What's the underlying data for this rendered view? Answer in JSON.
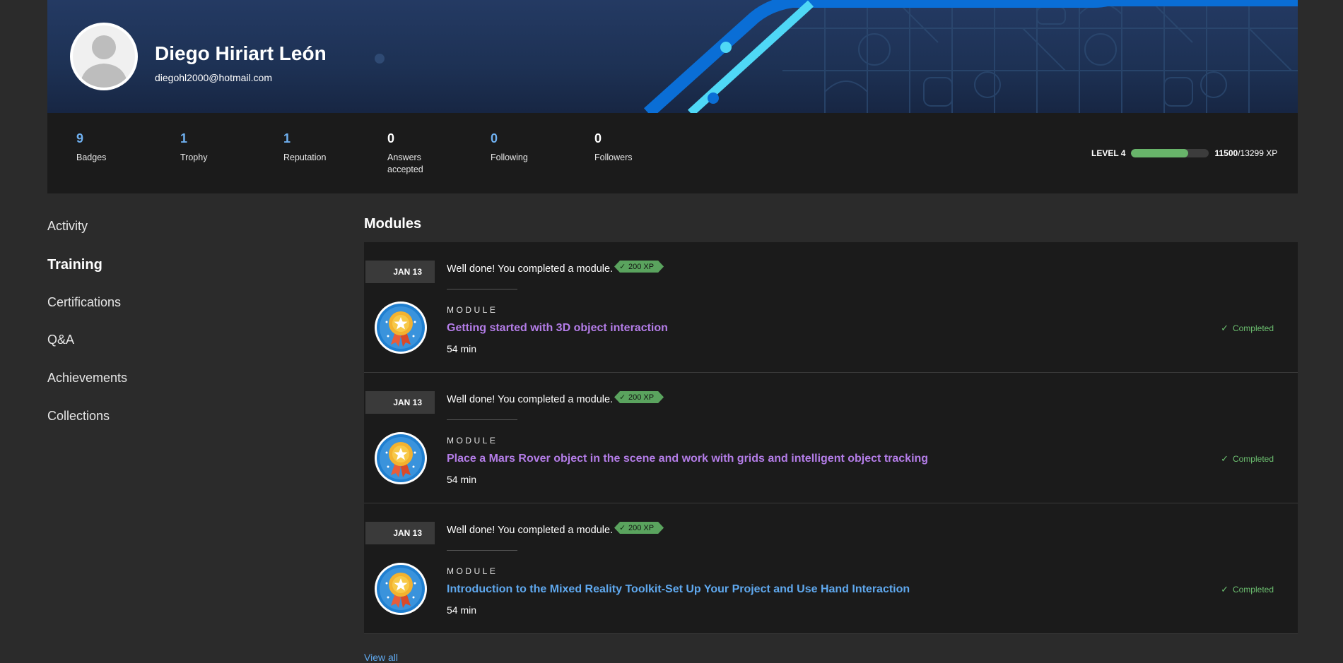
{
  "profile": {
    "name": "Diego Hiriart León",
    "email": "diegohl2000@hotmail.com"
  },
  "stats": [
    {
      "value": "9",
      "label": "Badges",
      "color": "blue"
    },
    {
      "value": "1",
      "label": "Trophy",
      "color": "blue"
    },
    {
      "value": "1",
      "label": "Reputation",
      "color": "blue"
    },
    {
      "value": "0",
      "label": "Answers accepted",
      "color": "white"
    },
    {
      "value": "0",
      "label": "Following",
      "color": "blue"
    },
    {
      "value": "0",
      "label": "Followers",
      "color": "white"
    }
  ],
  "level": {
    "label": "LEVEL 4",
    "xp_current": "11500",
    "xp_total": "/13299 XP",
    "progress_fraction": 0.73
  },
  "nav": {
    "items": [
      {
        "label": "Activity"
      },
      {
        "label": "Training"
      },
      {
        "label": "Certifications"
      },
      {
        "label": "Q&A"
      },
      {
        "label": "Achievements"
      },
      {
        "label": "Collections"
      }
    ],
    "active": "Training"
  },
  "modules": {
    "title": "Modules",
    "view_all": "View all",
    "items": [
      {
        "date": "JAN 13",
        "message": "Well done! You completed a module.",
        "xp": "200 XP",
        "kind": "MODULE",
        "title": "Getting started with 3D object interaction",
        "duration": "54 min",
        "status": "Completed"
      },
      {
        "date": "JAN 13",
        "message": "Well done! You completed a module.",
        "xp": "200 XP",
        "kind": "MODULE",
        "title": "Place a Mars Rover object in the scene and work with grids and intelligent object tracking",
        "duration": "54 min",
        "status": "Completed"
      },
      {
        "date": "JAN 13",
        "message": "Well done! You completed a module.",
        "xp": "200 XP",
        "kind": "MODULE",
        "title": "Introduction to the Mixed Reality Toolkit-Set Up Your Project and Use Hand Interaction",
        "duration": "54 min",
        "status": "Completed"
      }
    ]
  },
  "colors": {
    "background": "#2b2b2b",
    "panel": "#1b1b1b",
    "banner": "#1d3154",
    "link_purple": "#b47de8",
    "link_blue": "#5fa8ee",
    "success": "#6cc070"
  }
}
